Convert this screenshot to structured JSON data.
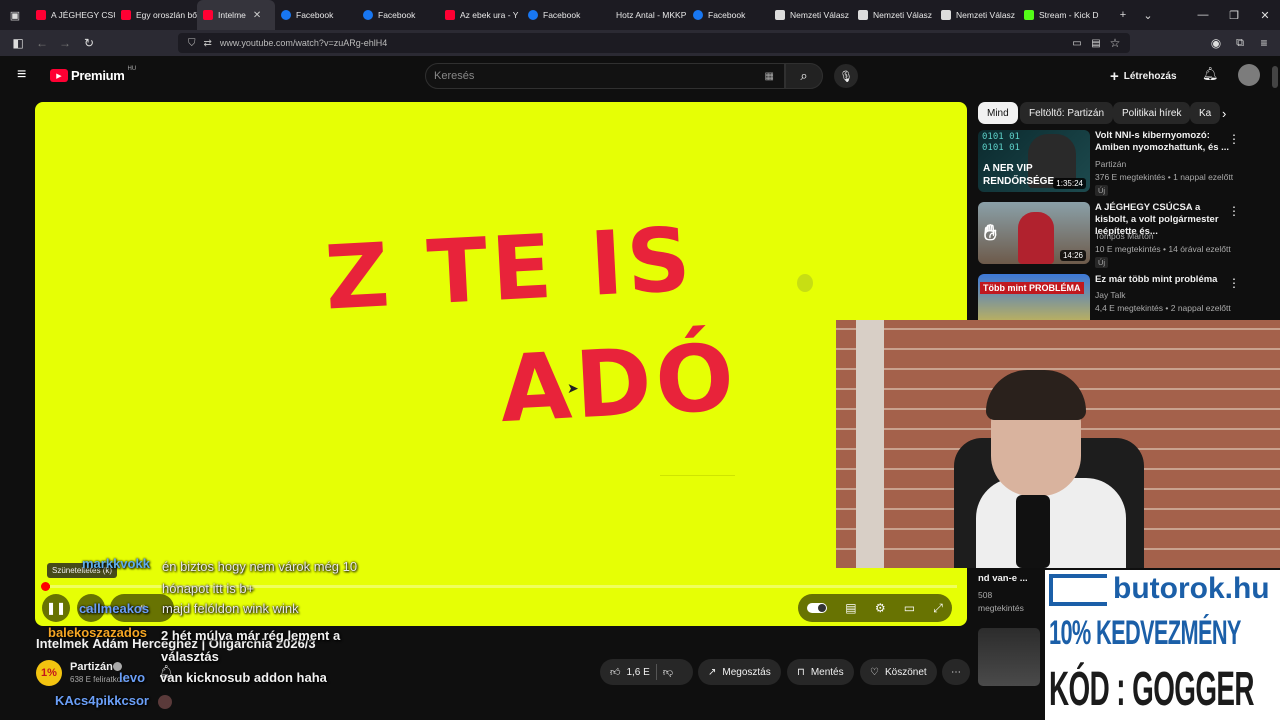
{
  "browser": {
    "tabs": [
      {
        "label": "A JÉGHEGY CSÚ",
        "icon": "youtube",
        "active": false
      },
      {
        "label": "Egy oroszlán bő",
        "icon": "youtube",
        "active": false
      },
      {
        "label": "Intelme",
        "icon": "youtube",
        "active": true
      },
      {
        "label": "Facebook",
        "icon": "facebook",
        "active": false
      },
      {
        "label": "Facebook",
        "icon": "facebook",
        "active": false
      },
      {
        "label": "Az ebek ura - Y",
        "icon": "youtube",
        "active": false
      },
      {
        "label": "Facebook",
        "icon": "facebook",
        "active": false
      },
      {
        "label": "Hotz Antal - MKKP",
        "icon": "none",
        "active": false
      },
      {
        "label": "Facebook",
        "icon": "facebook",
        "active": false
      },
      {
        "label": "Nemzeti Válasz",
        "icon": "nv",
        "active": false
      },
      {
        "label": "Nemzeti Válasz",
        "icon": "nv",
        "active": false
      },
      {
        "label": "Nemzeti Válasz",
        "icon": "nv",
        "active": false
      },
      {
        "label": "Stream - Kick D",
        "icon": "kick",
        "active": false
      }
    ],
    "url": "www.youtube.com/watch?v=zuARg-ehlH4"
  },
  "youtube": {
    "logo_label": "Premium",
    "logo_region": "HU",
    "search_placeholder": "Keresés",
    "create_label": "Létrehozás"
  },
  "video": {
    "overlay_line1": "Z TE IS",
    "overlay_line2": "ADÓ",
    "pause_tooltip": "Szüneteltetés (k)",
    "progress": 0.006,
    "title_line1": "Intelmek Ádám Herceghez | Oligarchia 2026/3",
    "channel": "Partizán",
    "subscribers": "638 E feliratkozó",
    "likes": "1,6 E",
    "share_label": "Megosztás",
    "save_label": "Mentés",
    "thanks_label": "Köszönet"
  },
  "sidebar": {
    "chips": [
      "Mind",
      "Feltöltő: Partizán",
      "Politikai hírek",
      "Ka"
    ],
    "recommendations": [
      {
        "title": "Volt NNI-s kibernyomozó: Amiben nyomozhattunk, és ...",
        "channel": "Partizán",
        "meta": "376 E megtekintés • 1 nappal ezelőtt",
        "badge": "Új",
        "duration": "1:35:24",
        "thumb_text": "A NER VIP RENDŐRSÉGE"
      },
      {
        "title": "A JÉGHEGY CSÚCSA a kisbolt, a volt polgármester leépítette és...",
        "channel": "Tompos Márton",
        "meta": "10 E megtekintés • 14 órával ezelőtt",
        "badge": "Új",
        "duration": "14:26",
        "thumb_text": ""
      },
      {
        "title": "Ez már több mint probléma",
        "channel": "Jay Talk",
        "meta": "4,4 E megtekintés • 2 nappal ezelőtt",
        "badge": "",
        "duration": "",
        "thumb_text": "Több mint PROBLÉMA"
      }
    ],
    "partial_title": "nd van-e ...",
    "partial_views": "508",
    "partial_views_label": "megtekintés"
  },
  "ad": {
    "brand": "butorok.hu",
    "line1": "10% KEDVEZMÉNY",
    "line2": "KÓD : GOGGER"
  },
  "chat": [
    {
      "user": "markkvokk",
      "user_color": "#5dadec",
      "text": "én biztos hogy nem várok még 10 hónapot itt is b+"
    },
    {
      "user": "callmeakos",
      "user_color": "#6b9ff7",
      "text": "majd felóldon wink wink"
    },
    {
      "user": "balekoszazados",
      "user_color": "#f5a623",
      "text": "2 hét múlva már rég lement a választás"
    },
    {
      "user": "levo",
      "user_color": "#6b9ff7",
      "text": "van kicknosub addon haha"
    },
    {
      "user": "KAcs4pikkcsor",
      "user_color": "#6b9ff7",
      "text": ""
    }
  ],
  "colors": {
    "video_bg": "#e6ff05",
    "overlay_text": "#e8233a",
    "yt_red": "#ff0033",
    "ad_blue": "#1b5fa8"
  }
}
